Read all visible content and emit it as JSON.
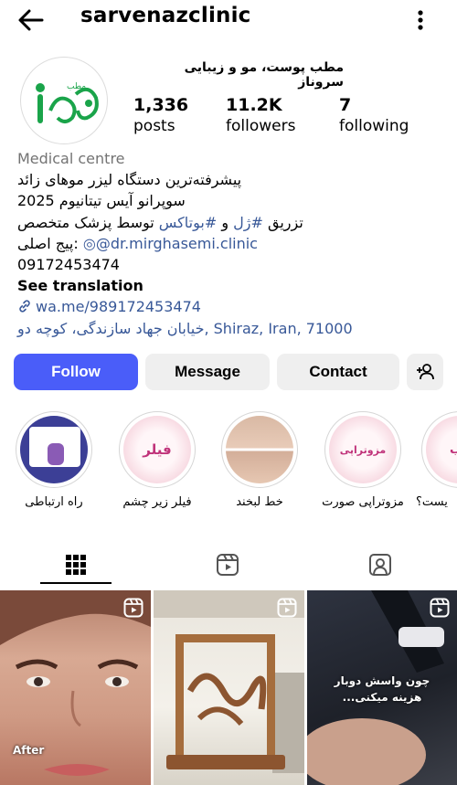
{
  "header": {
    "username": "sarvenazclinic",
    "back_icon": "back-arrow-icon",
    "more_icon": "more-vertical-icon"
  },
  "profile": {
    "display_name": "مطب پوست، مو و زیبایی سروناز",
    "avatar_logo_text": "مطب",
    "stats": {
      "posts_count": "1,336",
      "posts_label": "posts",
      "followers_count": "11.2K",
      "followers_label": "followers",
      "following_count": "7",
      "following_label": "following"
    }
  },
  "bio": {
    "category": "Medical centre",
    "line1": "پیشرفته‌ترین دستگاه لیزر موهای زائد",
    "line2": "سوپرانو آیس تیتانیوم 2025",
    "line3_prefix": "تزریق ",
    "line3_tag1": "#ژل",
    "line3_mid": " و ",
    "line3_tag2": "#بوتاکس",
    "line3_suffix": " توسط پزشک متخصص",
    "line4_label": "پیج اصلی:",
    "line4_mention": "@dr.mirghasemi.clinic",
    "phone": "09172453474",
    "see_translation": "See translation",
    "website": "wa.me/989172453474",
    "address": "خیابان جهاد سازندگی، کوچه دو, Shiraz, Iran, 71000"
  },
  "actions": {
    "follow": "Follow",
    "message": "Message",
    "contact": "Contact",
    "add_user_icon": "add-person-icon"
  },
  "highlights": [
    {
      "label": "راه ارتباطی",
      "cover_text": ""
    },
    {
      "label": "فیلر زیر چشم",
      "cover_text": "فیلر"
    },
    {
      "label": "خط لبخند",
      "cover_text": ""
    },
    {
      "label": "مزوتراپی صورت",
      "cover_text": "مزوتراپی"
    },
    {
      "label": "یست؟",
      "cover_text": "ب"
    }
  ],
  "tabs": [
    {
      "name": "grid-tab",
      "icon": "grid-icon"
    },
    {
      "name": "reels-tab",
      "icon": "reels-icon"
    },
    {
      "name": "tagged-tab",
      "icon": "tagged-person-icon"
    }
  ],
  "posts": [
    {
      "caption": "After",
      "type": "reel"
    },
    {
      "caption": "",
      "type": "reel"
    },
    {
      "caption": "چون واسش دوبار هزینه میکنی...",
      "type": "reel"
    }
  ],
  "colors": {
    "follow_button": "#4a5df9",
    "secondary_button": "#efefef",
    "link": "#385898",
    "category_text": "#737373"
  }
}
